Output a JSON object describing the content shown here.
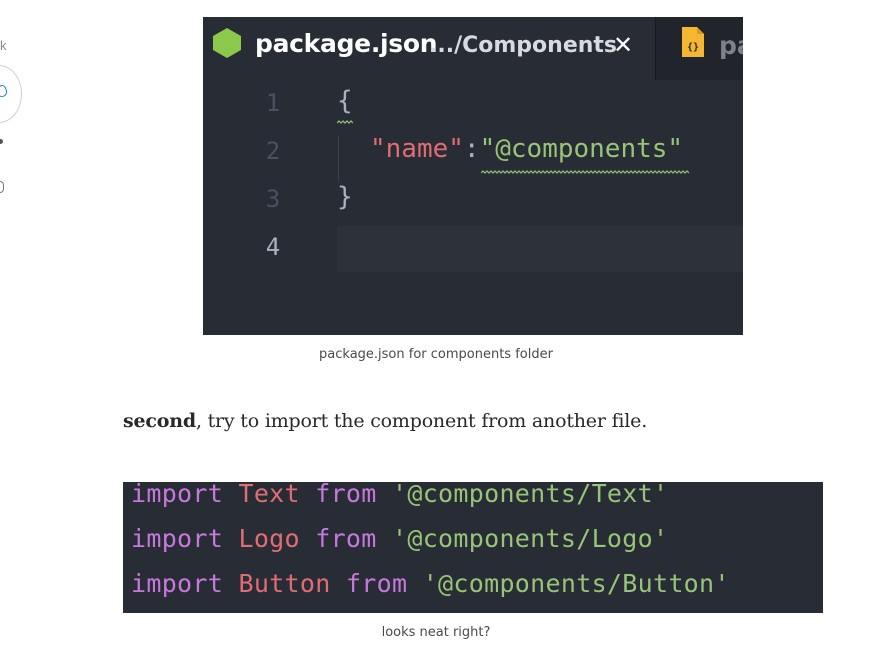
{
  "left_rail": {
    "x_glyph": "k"
  },
  "editor": {
    "active_tab": {
      "title": "package.json",
      "path": ".../Components",
      "close_glyph": "✕"
    },
    "second_tab": {
      "title": "pa",
      "icon_glyph": "{}"
    },
    "line_numbers": [
      "1",
      "2",
      "3",
      "4"
    ],
    "code": {
      "open_brace": "{",
      "key": "\"name\"",
      "colon": ":",
      "value": "\"@components\"",
      "close_brace": "}"
    },
    "colors": {
      "background": "#282c34",
      "tabbar": "#21252b",
      "hex_icon": "#8cc84b",
      "json_icon": "#f5b731",
      "key": "#e06c75",
      "string": "#98c379"
    }
  },
  "captions": {
    "first": "package.json for components folder",
    "second": "looks neat right?"
  },
  "paragraph": {
    "bold": "second",
    "rest": ", try to import the component from another file."
  },
  "imports": [
    {
      "keyword": "import",
      "name": "Text",
      "from": "from",
      "path": "'@components/Text'"
    },
    {
      "keyword": "import",
      "name": "Logo",
      "from": "from",
      "path": "'@components/Logo'"
    },
    {
      "keyword": "import",
      "name": "Button",
      "from": "from",
      "path": "'@components/Button'"
    }
  ]
}
